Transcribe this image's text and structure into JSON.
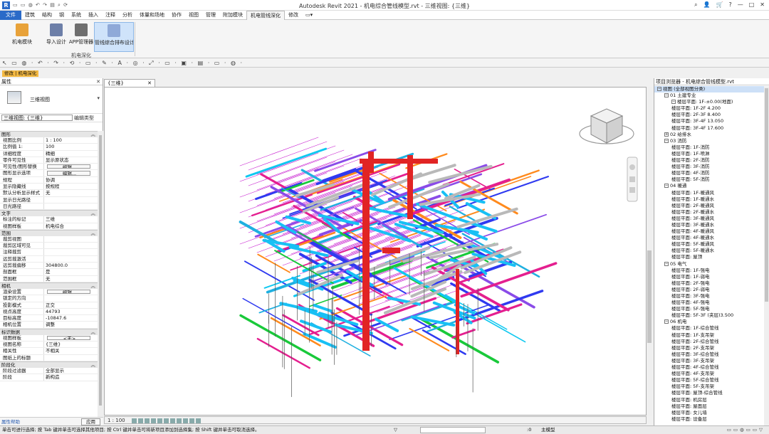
{
  "titlebar": {
    "app_icon": "R",
    "quick_access": "▭ ▭ ◍ ↶ ↷ ▤ ⌕ ⟳",
    "title": "Autodesk Revit 2021 - 机电综合管线模型.rvt - 三维视图: {三维}",
    "search_icon": "⌕",
    "user_icon": "👤",
    "cart_icon": "🛒",
    "help_icon": "?",
    "minimize": "—",
    "maximize": "□",
    "close": "✕"
  },
  "menu": {
    "file": "文件",
    "tabs": [
      "建筑",
      "结构",
      "钢",
      "系统",
      "插入",
      "注释",
      "分析",
      "体量和场地",
      "协作",
      "视图",
      "管理",
      "附加模块",
      "机电管线深化",
      "修改",
      "▭▾"
    ],
    "active_index": 12
  },
  "ribbon": {
    "buttons": [
      {
        "label": "机电模块",
        "icon": "box-icon",
        "color": "#e8a23a"
      },
      {
        "label": "导入设计",
        "icon": "document-icon",
        "color": "#6d7fa8"
      },
      {
        "label": "APP管理器",
        "icon": "app-manager-icon",
        "color": "#6e6e6e"
      },
      {
        "label": "管线综合排布设计",
        "icon": "layout-icon",
        "color": "#8fa9d8"
      }
    ],
    "panel_label": "机电深化",
    "modify_label": "修改 | 机电深化"
  },
  "qat": "↖ ▭ ◍ · ↶ · ↷ · ⟲ · ▭ · ✎ · A · ◎ · ⤢ · ▭ · ▣ · ▤ · ▭ · ◍ ·",
  "properties": {
    "title": "属性",
    "close": "✕",
    "type_name": "三维视图",
    "instance_selector": "三维视图: {三维}",
    "edit_type": "编辑类型",
    "groups": [
      {
        "name": "图形",
        "rows": [
          [
            "视图比例",
            "1 : 100",
            ""
          ],
          [
            "比例值 1:",
            "100",
            ""
          ],
          [
            "详细程度",
            "精细",
            ""
          ],
          [
            "零件可见性",
            "显示原状态",
            ""
          ],
          [
            "可见性/图形替换",
            "编辑...",
            "btn"
          ],
          [
            "图形显示选项",
            "编辑...",
            "btn"
          ],
          [
            "规程",
            "协调",
            ""
          ],
          [
            "显示隐藏线",
            "按规程",
            ""
          ],
          [
            "默认分析显示样式",
            "无",
            ""
          ],
          [
            "显示日光路径",
            "",
            ""
          ],
          [
            "日光路径",
            "",
            ""
          ]
        ]
      },
      {
        "name": "文字",
        "rows": [
          [
            "标注的标记",
            "三维",
            ""
          ],
          [
            "视图样板",
            "机电综合",
            ""
          ]
        ]
      },
      {
        "name": "范围",
        "rows": [
          [
            "裁剪视图",
            "",
            ""
          ],
          [
            "裁剪区域可见",
            "",
            ""
          ],
          [
            "注释裁剪",
            "",
            ""
          ],
          [
            "远剪裁激活",
            "",
            ""
          ],
          [
            "远剪裁偏移",
            "304800.0",
            ""
          ],
          [
            "剖面框",
            "是",
            ""
          ],
          [
            "范围框",
            "无",
            ""
          ]
        ]
      },
      {
        "name": "相机",
        "rows": [
          [
            "渲染设置",
            "编辑...",
            "btn"
          ],
          [
            "锁定的方向",
            "",
            ""
          ],
          [
            "投影模式",
            "正交",
            ""
          ],
          [
            "视点高度",
            "44793",
            ""
          ],
          [
            "目标高度",
            "-10847.6",
            ""
          ],
          [
            "相机位置",
            "调整",
            ""
          ]
        ]
      },
      {
        "name": "标识数据",
        "rows": [
          [
            "视图样板",
            "<无>",
            "btn"
          ],
          [
            "视图名称",
            "{三维}",
            ""
          ],
          [
            "相关性",
            "不相关",
            ""
          ],
          [
            "图纸上的标题",
            "",
            ""
          ]
        ]
      },
      {
        "name": "阶段化",
        "rows": [
          [
            "阶段过滤器",
            "全部显示",
            ""
          ],
          [
            "阶段",
            "新构造",
            ""
          ]
        ]
      }
    ],
    "help_link": "属性帮助",
    "apply": "应用"
  },
  "view": {
    "tab_label": "{三维}",
    "tab_close": "✕",
    "scale": "1 : 100"
  },
  "browser": {
    "title": "项目浏览器 - 机电综合管线模型.rvt",
    "items": [
      {
        "level": 0,
        "box": "−",
        "text": "视图 (全部视图分类)",
        "sel": true
      },
      {
        "level": 1,
        "box": "−",
        "text": "01 土建专业"
      },
      {
        "level": 2,
        "box": "−",
        "text": "楼层平面: 1F-±0.00(地面)"
      },
      {
        "level": 2,
        "box": "",
        "text": "楼层平面: 1F-2F 4.200"
      },
      {
        "level": 2,
        "box": "",
        "text": "楼层平面: 2F-3F 8.400"
      },
      {
        "level": 2,
        "box": "",
        "text": "楼层平面: 3F-4F 13.050"
      },
      {
        "level": 2,
        "box": "",
        "text": "楼层平面: 3F-4F 17.600"
      },
      {
        "level": 1,
        "box": "+",
        "text": "02 给排水"
      },
      {
        "level": 1,
        "box": "−",
        "text": "03 消防"
      },
      {
        "level": 2,
        "box": "",
        "text": "楼层平面: 1F-消防"
      },
      {
        "level": 2,
        "box": "",
        "text": "楼层平面: 1F-喷淋"
      },
      {
        "level": 2,
        "box": "",
        "text": "楼层平面: 2F-消防"
      },
      {
        "level": 2,
        "box": "",
        "text": "楼层平面: 3F-消防"
      },
      {
        "level": 2,
        "box": "",
        "text": "楼层平面: 4F-消防"
      },
      {
        "level": 2,
        "box": "",
        "text": "楼层平面: 5F-消防"
      },
      {
        "level": 1,
        "box": "−",
        "text": "04 暖通"
      },
      {
        "level": 2,
        "box": "",
        "text": "楼层平面: 1F-暖通风"
      },
      {
        "level": 2,
        "box": "",
        "text": "楼层平面: 1F-暖通水"
      },
      {
        "level": 2,
        "box": "",
        "text": "楼层平面: 2F-暖通风"
      },
      {
        "level": 2,
        "box": "",
        "text": "楼层平面: 2F-暖通水"
      },
      {
        "level": 2,
        "box": "",
        "text": "楼层平面: 3F-暖通风"
      },
      {
        "level": 2,
        "box": "",
        "text": "楼层平面: 3F-暖通水"
      },
      {
        "level": 2,
        "box": "",
        "text": "楼层平面: 4F-暖通风"
      },
      {
        "level": 2,
        "box": "",
        "text": "楼层平面: 4F-暖通水"
      },
      {
        "level": 2,
        "box": "",
        "text": "楼层平面: 5F-暖通风"
      },
      {
        "level": 2,
        "box": "",
        "text": "楼层平面: 5F-暖通水"
      },
      {
        "level": 2,
        "box": "",
        "text": "楼层平面: 屋顶"
      },
      {
        "level": 1,
        "box": "−",
        "text": "05 电气"
      },
      {
        "level": 2,
        "box": "",
        "text": "楼层平面: 1F-强电"
      },
      {
        "level": 2,
        "box": "",
        "text": "楼层平面: 1F-弱电"
      },
      {
        "level": 2,
        "box": "",
        "text": "楼层平面: 2F-强电"
      },
      {
        "level": 2,
        "box": "",
        "text": "楼层平面: 2F-弱电"
      },
      {
        "level": 2,
        "box": "",
        "text": "楼层平面: 3F-强电"
      },
      {
        "level": 2,
        "box": "",
        "text": "楼层平面: 4F-强电"
      },
      {
        "level": 2,
        "box": "",
        "text": "楼层平面: 5F-强电"
      },
      {
        "level": 2,
        "box": "",
        "text": "楼层平面: 5F-3F (夹层)3.500"
      },
      {
        "level": 1,
        "box": "−",
        "text": "06 机电"
      },
      {
        "level": 2,
        "box": "",
        "text": "楼层平面: 1F-综合管线"
      },
      {
        "level": 2,
        "box": "",
        "text": "楼层平面: 1F-支吊架"
      },
      {
        "level": 2,
        "box": "",
        "text": "楼层平面: 2F-综合管线"
      },
      {
        "level": 2,
        "box": "",
        "text": "楼层平面: 2F-支吊架"
      },
      {
        "level": 2,
        "box": "",
        "text": "楼层平面: 3F-综合管线"
      },
      {
        "level": 2,
        "box": "",
        "text": "楼层平面: 3F-支吊架"
      },
      {
        "level": 2,
        "box": "",
        "text": "楼层平面: 4F-综合管线"
      },
      {
        "level": 2,
        "box": "",
        "text": "楼层平面: 4F-支吊架"
      },
      {
        "level": 2,
        "box": "",
        "text": "楼层平面: 5F-综合管线"
      },
      {
        "level": 2,
        "box": "",
        "text": "楼层平面: 5F-支吊架"
      },
      {
        "level": 2,
        "box": "",
        "text": "楼层平面: 屋顶-综合管线"
      },
      {
        "level": 2,
        "box": "",
        "text": "楼层平面: 机房层"
      },
      {
        "level": 2,
        "box": "",
        "text": "楼层平面: 屋面层"
      },
      {
        "level": 2,
        "box": "",
        "text": "楼层平面: 女儿墙"
      },
      {
        "level": 2,
        "box": "",
        "text": "楼层平面: 设备层"
      }
    ]
  },
  "status": {
    "message": "单击可进行选择; 按 Tab 键并单击可选择其他项目; 按 Ctrl 键并单击可将新项目添加到选择集; 按 Shift 键并单击可取消选择。",
    "filter_icon": "▽",
    "zero": ":0",
    "main_model": "主模型"
  }
}
